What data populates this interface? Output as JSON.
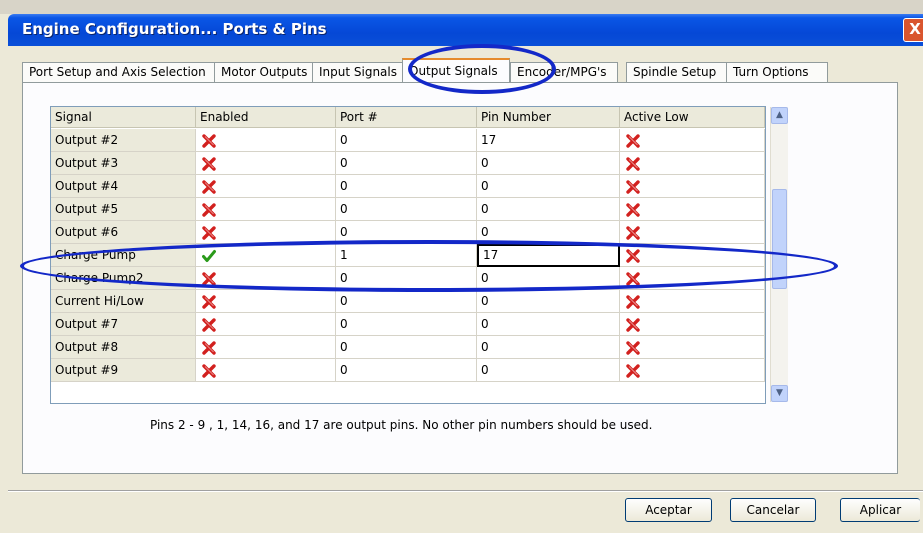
{
  "window": {
    "title": "Engine Configuration... Ports & Pins",
    "close_glyph": "X"
  },
  "tabs": [
    {
      "label": "Port Setup and Axis Selection"
    },
    {
      "label": "Motor Outputs"
    },
    {
      "label": "Input Signals"
    },
    {
      "label": "Output Signals",
      "active": true
    },
    {
      "label": "Encoder/MPG's"
    },
    {
      "label": "Spindle Setup"
    },
    {
      "label": "Turn Options"
    }
  ],
  "table": {
    "columns": [
      "Signal",
      "Enabled",
      "Port #",
      "Pin Number",
      "Active Low"
    ],
    "rows": [
      {
        "signal": "Output #2",
        "enabled": false,
        "port": "0",
        "pin": "17",
        "active_low": false
      },
      {
        "signal": "Output #3",
        "enabled": false,
        "port": "0",
        "pin": "0",
        "active_low": false
      },
      {
        "signal": "Output #4",
        "enabled": false,
        "port": "0",
        "pin": "0",
        "active_low": false
      },
      {
        "signal": "Output #5",
        "enabled": false,
        "port": "0",
        "pin": "0",
        "active_low": false
      },
      {
        "signal": "Output #6",
        "enabled": false,
        "port": "0",
        "pin": "0",
        "active_low": false
      },
      {
        "signal": "Charge Pump",
        "enabled": true,
        "port": "1",
        "pin": "17",
        "active_low": false,
        "editing": true
      },
      {
        "signal": "Charge Pump2",
        "enabled": false,
        "port": "0",
        "pin": "0",
        "active_low": false
      },
      {
        "signal": "Current Hi/Low",
        "enabled": false,
        "port": "0",
        "pin": "0",
        "active_low": false
      },
      {
        "signal": "Output #7",
        "enabled": false,
        "port": "0",
        "pin": "0",
        "active_low": false
      },
      {
        "signal": "Output #8",
        "enabled": false,
        "port": "0",
        "pin": "0",
        "active_low": false
      },
      {
        "signal": "Output #9",
        "enabled": false,
        "port": "0",
        "pin": "0",
        "active_low": false
      }
    ]
  },
  "note": "Pins 2 - 9 , 1, 14, 16, and 17 are output pins. No  other pin numbers should be used.",
  "buttons": {
    "accept": "Aceptar",
    "cancel": "Cancelar",
    "apply": "Aplicar"
  },
  "colors": {
    "annotation": "#1328c8",
    "xmark": "#d2201e",
    "check": "#2a9a1a"
  },
  "icons": {
    "enabled_false": "red-x-icon",
    "enabled_true": "green-check-icon"
  }
}
